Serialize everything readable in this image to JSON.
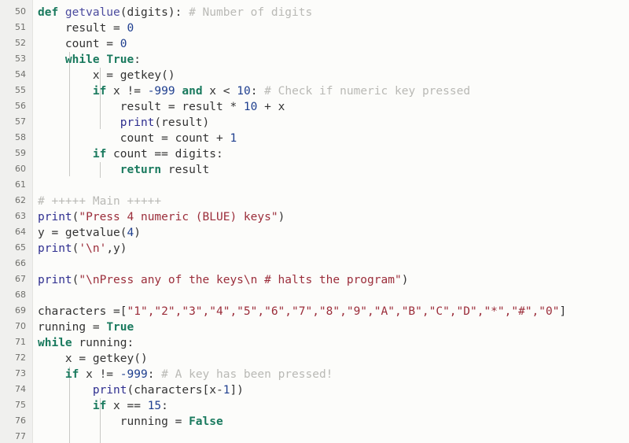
{
  "editor": {
    "language": "python",
    "font_size_px": 14.5,
    "line_height_px": 20,
    "colors": {
      "background": "#fcfcfa",
      "gutter_background": "#f0f0ee",
      "gutter_text": "#70706c",
      "default_text": "#333333",
      "keyword": "#1a7a5e",
      "function_def": "#4b4b9e",
      "builtin": "#2e2e8f",
      "number": "#1f3f8f",
      "string": "#9b2d3a",
      "comment": "#b9b9b5",
      "indent_guide": "#c9c9c5"
    },
    "first_visible_line": 50,
    "last_visible_line": 77
  },
  "lines": [
    {
      "n": "50",
      "text": ""
    },
    {
      "n": "51",
      "text": "def getvalue(digits): # Number of digits"
    },
    {
      "n": "52",
      "text": "    result = 0"
    },
    {
      "n": "53",
      "text": "    count = 0"
    },
    {
      "n": "54",
      "text": "    while True:"
    },
    {
      "n": "55",
      "text": "        x = getkey()"
    },
    {
      "n": "56",
      "text": "        if x != -999 and x < 10: # Check if numeric key pressed"
    },
    {
      "n": "57",
      "text": "            result = result * 10 + x"
    },
    {
      "n": "58",
      "text": "            print(result)"
    },
    {
      "n": "59",
      "text": "            count = count + 1"
    },
    {
      "n": "60",
      "text": "        if count == digits:"
    },
    {
      "n": "61",
      "text": "            return result"
    },
    {
      "n": "62",
      "text": ""
    },
    {
      "n": "63",
      "text": "# +++++ Main +++++"
    },
    {
      "n": "64",
      "text": "print(\"Press 4 numeric (BLUE) keys\")"
    },
    {
      "n": "65",
      "text": "y = getvalue(4)"
    },
    {
      "n": "66",
      "text": "print('\\n',y)"
    },
    {
      "n": "67",
      "text": ""
    },
    {
      "n": "68",
      "text": "print(\"\\nPress any of the keys\\n # halts the program\")"
    },
    {
      "n": "69",
      "text": ""
    },
    {
      "n": "70",
      "text": "characters =[\"1\",\"2\",\"3\",\"4\",\"5\",\"6\",\"7\",\"8\",\"9\",\"A\",\"B\",\"C\",\"D\",\"*\",\"#\",\"0\"]"
    },
    {
      "n": "71",
      "text": "running = True"
    },
    {
      "n": "72",
      "text": "while running:"
    },
    {
      "n": "73",
      "text": "    x = getkey()"
    },
    {
      "n": "74",
      "text": "    if x != -999: # A key has been pressed!"
    },
    {
      "n": "75",
      "text": "        print(characters[x-1])"
    },
    {
      "n": "76",
      "text": "        if x == 15:"
    },
    {
      "n": "77",
      "text": "            running = False"
    }
  ],
  "line_numbers": {
    "l50": "50",
    "l51": "51",
    "l52": "52",
    "l53": "53",
    "l54": "54",
    "l55": "55",
    "l56": "56",
    "l57": "57",
    "l58": "58",
    "l59": "59",
    "l60": "60",
    "l61": "61",
    "l62": "62",
    "l63": "63",
    "l64": "64",
    "l65": "65",
    "l66": "66",
    "l67": "67",
    "l68": "68",
    "l69": "69",
    "l70": "70",
    "l71": "71",
    "l72": "72",
    "l73": "73",
    "l74": "74",
    "l75": "75",
    "l76": "76",
    "l77": "77"
  },
  "tokens": {
    "l51": {
      "kw_def": "def",
      "fn_name": " getvalue",
      "sig": "(digits): ",
      "comment": "# Number of digits"
    },
    "l52": {
      "ind": "    ",
      "name": "result = ",
      "num": "0"
    },
    "l53": {
      "ind": "    ",
      "name": "count = ",
      "num": "0"
    },
    "l54": {
      "ind": "    ",
      "kw_while": "while",
      "sp": " ",
      "kw_true": "True",
      "colon": ":"
    },
    "l55": {
      "ind": "        ",
      "body": "x = getkey()"
    },
    "l56": {
      "ind": "        ",
      "kw_if": "if",
      "a": " x != ",
      "num1": "-999",
      "sp1": " ",
      "kw_and": "and",
      "b": " x < ",
      "num2": "10",
      "colon": ": ",
      "comment": "# Check if numeric key pressed"
    },
    "l57": {
      "ind": "            ",
      "a": "result = result ",
      "op": "*",
      "b": " ",
      "num1": "10",
      "c": " + x"
    },
    "l58": {
      "ind": "            ",
      "bi": "print",
      "rest": "(result)"
    },
    "l59": {
      "ind": "            ",
      "a": "count = count + ",
      "num": "1"
    },
    "l60": {
      "ind": "        ",
      "kw_if": "if",
      "rest": " count == digits:"
    },
    "l61": {
      "ind": "            ",
      "kw_return": "return",
      "rest": " result"
    },
    "l63": {
      "comment": "# +++++ Main +++++"
    },
    "l64": {
      "bi": "print",
      "p1": "(",
      "str": "\"Press 4 numeric (BLUE) keys\"",
      "p2": ")"
    },
    "l65": {
      "a": "y = getvalue(",
      "num": "4",
      "b": ")"
    },
    "l66": {
      "bi": "print",
      "p1": "(",
      "str": "'\\n'",
      "b": ",y)"
    },
    "l68": {
      "bi": "print",
      "p1": "(",
      "str": "\"\\nPress any of the keys\\n # halts the program\"",
      "p2": ")"
    },
    "l70": {
      "a": "characters =[",
      "str": "\"1\",\"2\",\"3\",\"4\",\"5\",\"6\",\"7\",\"8\",\"9\",\"A\",\"B\",\"C\",\"D\",\"*\",\"#\",\"0\"",
      "b": "]"
    },
    "l71": {
      "a": "running = ",
      "kw_true": "True"
    },
    "l72": {
      "kw_while": "while",
      "rest": " running:"
    },
    "l73": {
      "ind": "    ",
      "rest": "x = getkey()"
    },
    "l74": {
      "ind": "    ",
      "kw_if": "if",
      "a": " x != ",
      "num": "-999",
      "colon": ": ",
      "comment": "# A key has been pressed!"
    },
    "l75": {
      "ind": "        ",
      "bi": "print",
      "rest": "(characters[x-",
      "num": "1",
      "rest2": "])"
    },
    "l76": {
      "ind": "        ",
      "kw_if": "if",
      "a": " x == ",
      "num": "15",
      "colon": ":"
    },
    "l77": {
      "ind": "            ",
      "a": "running = ",
      "kw_false": "False"
    }
  }
}
